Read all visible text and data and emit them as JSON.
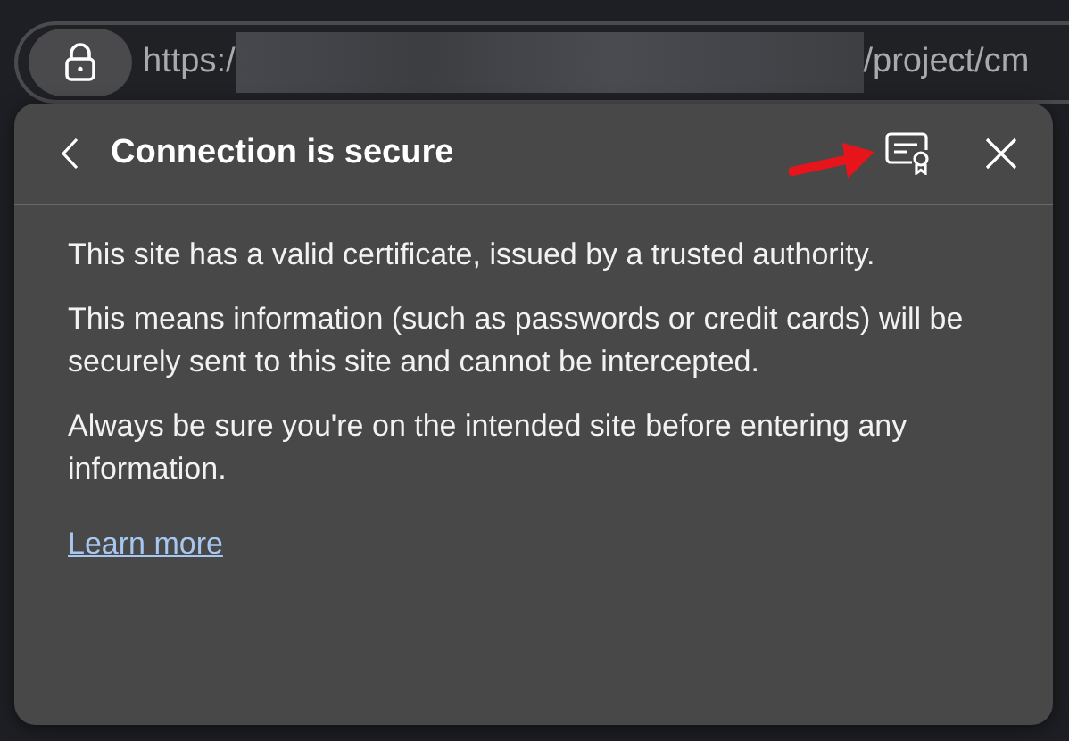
{
  "address_bar": {
    "url_start": "https:/",
    "url_end": "/project/cm"
  },
  "popup": {
    "title": "Connection is secure",
    "paragraphs": [
      "This site has a valid certificate, issued by a trusted authority.",
      "This means information (such as passwords or credit cards) will be securely sent to this site and cannot be intercepted.",
      "Always be sure you're on the intended site before entering any information."
    ],
    "link": "Learn more"
  }
}
